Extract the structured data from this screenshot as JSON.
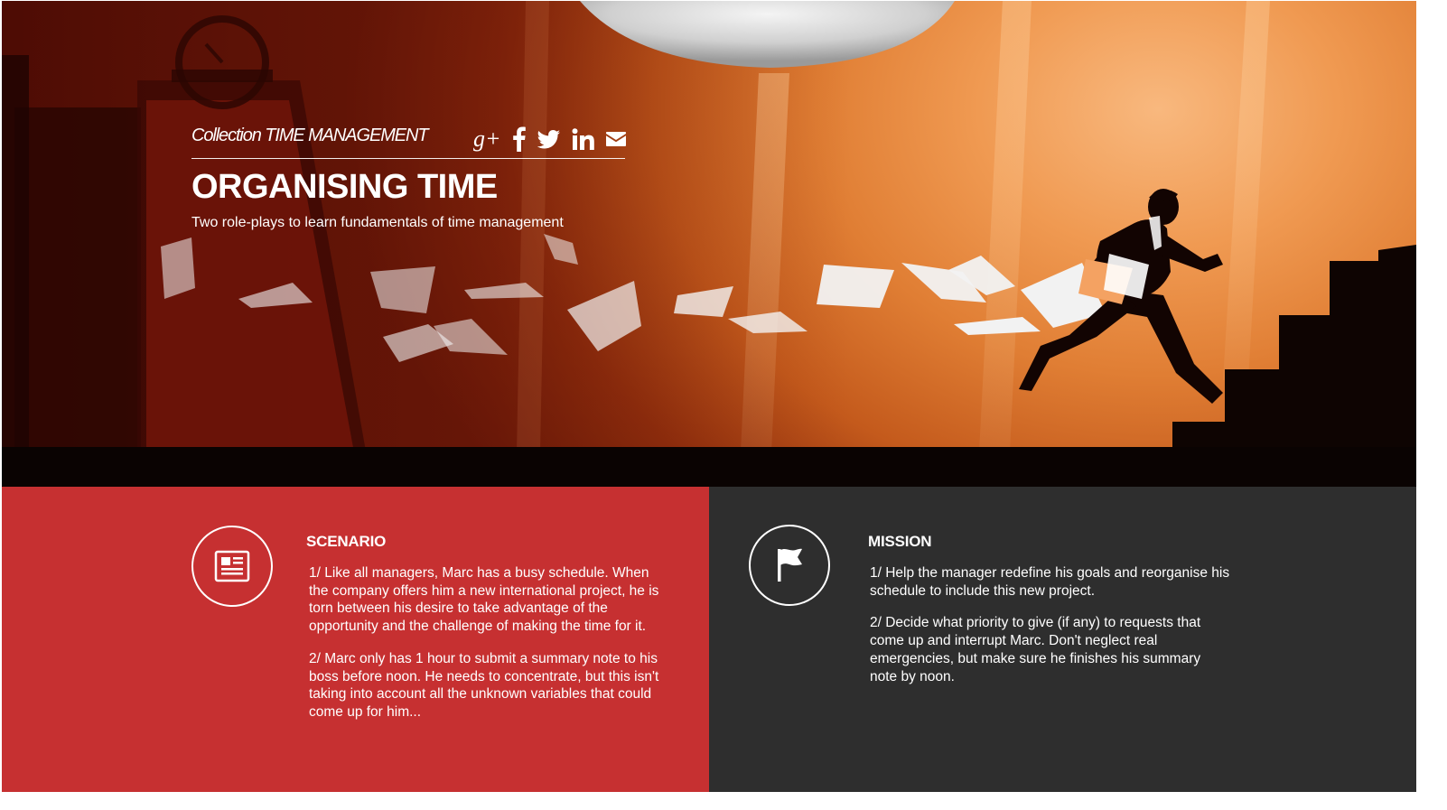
{
  "hero": {
    "collection": "Collection TIME MANAGEMENT",
    "title": "ORGANISING TIME",
    "subtitle": "Two role-plays to learn fundamentals of time management",
    "social": [
      {
        "name": "google-plus",
        "icon": "google-plus-icon",
        "glyph": "g+"
      },
      {
        "name": "facebook",
        "icon": "facebook-icon"
      },
      {
        "name": "twitter",
        "icon": "twitter-icon"
      },
      {
        "name": "linkedin",
        "icon": "linkedin-icon",
        "glyph": "in"
      },
      {
        "name": "email",
        "icon": "email-icon"
      }
    ]
  },
  "scenario": {
    "heading": "SCENARIO",
    "icon": "document-icon",
    "paragraphs": [
      "1/ Like all managers, Marc has a busy schedule. When the company offers him a new international project, he is torn between his desire to take advantage of the opportunity and the challenge of making the time for it.",
      "2/ Marc only has 1 hour to submit a summary note to his boss before noon. He needs to concentrate, but this isn't taking into account all the unknown variables that could come up for him..."
    ]
  },
  "mission": {
    "heading": "MISSION",
    "icon": "flag-icon",
    "paragraphs": [
      "1/ Help the manager redefine his goals and reorganise his schedule to include this new project.",
      "2/ Decide what priority to give (if any) to requests that come up and interrupt Marc.  Don't neglect real emergencies, but make sure he finishes his summary note by noon."
    ]
  },
  "colors": {
    "scenario_bg": "#c63031",
    "mission_bg": "#2e2e2e",
    "hero_orange": "#f09a52",
    "hero_dark": "#5e1406"
  }
}
